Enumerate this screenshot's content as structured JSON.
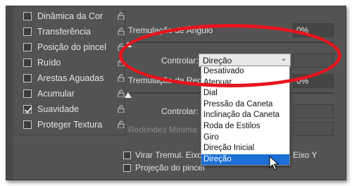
{
  "sidebar": {
    "items": [
      {
        "label": "Dinâmica da Cor",
        "checked": false
      },
      {
        "label": "Transferência",
        "checked": false
      },
      {
        "label": "Posição do pincel",
        "checked": false
      },
      {
        "label": "Ruído",
        "checked": false
      },
      {
        "label": "Arestas Aguadas",
        "checked": false
      },
      {
        "label": "Acumular",
        "checked": false
      },
      {
        "label": "Suavidade",
        "checked": true
      },
      {
        "label": "Proteger Textura",
        "checked": false
      }
    ]
  },
  "angle": {
    "title": "Tremulação de Ângulo",
    "value": "0%",
    "control_label": "Controlar:",
    "control_value": "Direção"
  },
  "roundness": {
    "title": "Tremulação de Redo",
    "value": "0%",
    "control_label": "Controlar:",
    "min_label": "Redondez Mínima"
  },
  "options": {
    "flip_x": "Virar Tremul. Eixo",
    "flip_y": "Eixo Y",
    "projection": "Projeção do pincel"
  },
  "dropdown": {
    "items": [
      "Desativado",
      "Atenuar",
      "Dial",
      "Pressão da Caneta",
      "Inclinação da Caneta",
      "Roda de Estilos",
      "Giro",
      "Direção Inicial",
      "Direção"
    ],
    "selected_index": 8
  },
  "colors": {
    "panel": "#535353",
    "highlight_ring": "#e8141d",
    "menu_selection": "#1b6fd6"
  }
}
